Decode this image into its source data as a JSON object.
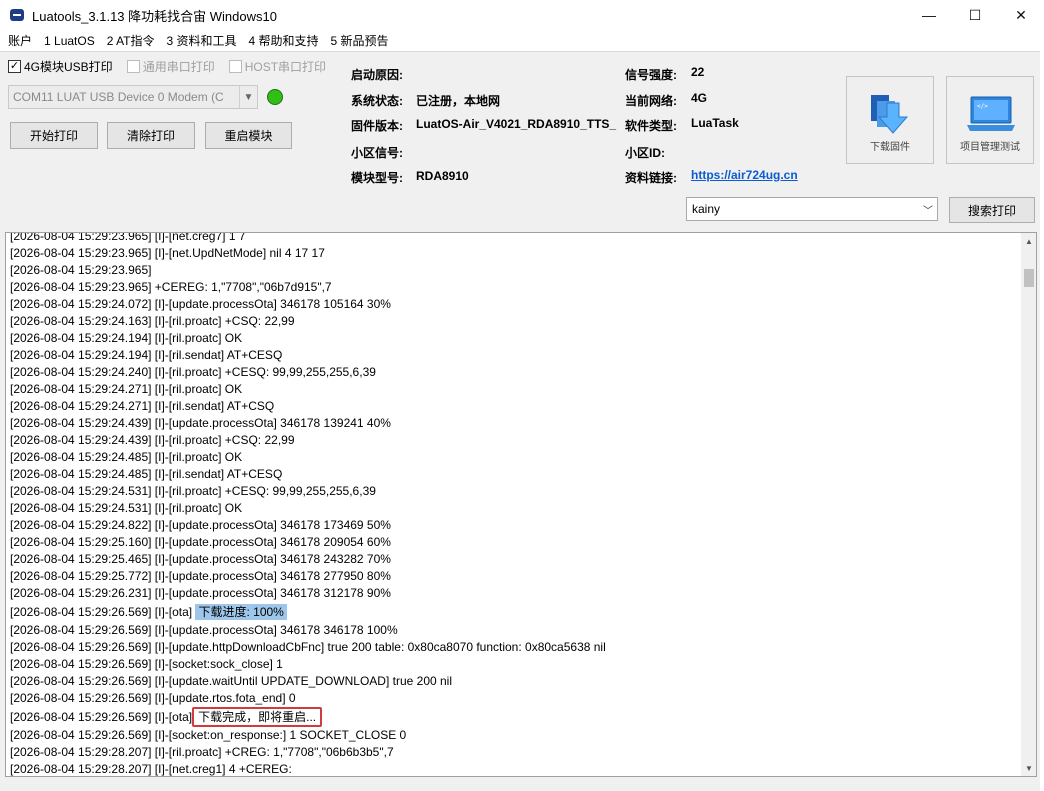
{
  "window": {
    "title": "Luatools_3.1.13 降功耗找合宙 Windows10",
    "minimize": "—",
    "maximize": "☐",
    "close": "✕"
  },
  "menu": [
    "账户",
    "1 LuatOS",
    "2 AT指令",
    "3 资料和工具",
    "4 帮助和支持",
    "5 新品预告"
  ],
  "options": {
    "usb_print": {
      "label": "4G模块USB打印",
      "checked": true
    },
    "serial_print": {
      "label": "通用串口打印",
      "checked": false
    },
    "host_print": {
      "label": "HOST串口打印",
      "checked": false
    }
  },
  "port": {
    "value": "COM11 LUAT USB Device 0 Modem (C",
    "status_color": "#2fbf17"
  },
  "buttons": {
    "start_print": "开始打印",
    "clear_print": "清除打印",
    "restart_module": "重启模块",
    "search_print": "搜索打印"
  },
  "info": {
    "boot_reason": {
      "label": "启动原因:",
      "value": ""
    },
    "system_status": {
      "label": "系统状态:",
      "value": "已注册，本地网"
    },
    "firmware": {
      "label": "固件版本:",
      "value": "LuatOS-Air_V4021_RDA8910_TTS_"
    },
    "cell_signal": {
      "label": "小区信号:",
      "value": ""
    },
    "module_model": {
      "label": "模块型号:",
      "value": "RDA8910"
    },
    "signal_strength": {
      "label": "信号强度:",
      "value": "22"
    },
    "network": {
      "label": "当前网络:",
      "value": "4G"
    },
    "software_type": {
      "label": "软件类型:",
      "value": "LuaTask"
    },
    "cell_id": {
      "label": "小区ID:",
      "value": ""
    },
    "resource_link": {
      "label": "资料链接:",
      "value": "https://air724ug.cn"
    }
  },
  "tools": {
    "download_firmware": "下载固件",
    "project_manager": "项目管理测试"
  },
  "filter": {
    "value": "kainy"
  },
  "log": [
    {
      "text": "[2026-08-04 15:29:23.965] [I]-[net.creg7] 1 7"
    },
    {
      "text": "[2026-08-04 15:29:23.965] [I]-[net.UpdNetMode] nil 4 17 17"
    },
    {
      "text": "[2026-08-04 15:29:23.965]"
    },
    {
      "text": "[2026-08-04 15:29:23.965] +CEREG: 1,\"7708\",\"06b7d915\",7"
    },
    {
      "text": "[2026-08-04 15:29:24.072] [I]-[update.processOta] 346178 105164 30%"
    },
    {
      "text": "[2026-08-04 15:29:24.163] [I]-[ril.proatc] +CSQ: 22,99"
    },
    {
      "text": "[2026-08-04 15:29:24.194] [I]-[ril.proatc] OK"
    },
    {
      "text": "[2026-08-04 15:29:24.194] [I]-[ril.sendat] AT+CESQ"
    },
    {
      "text": "[2026-08-04 15:29:24.240] [I]-[ril.proatc] +CESQ: 99,99,255,255,6,39"
    },
    {
      "text": "[2026-08-04 15:29:24.271] [I]-[ril.proatc] OK"
    },
    {
      "text": "[2026-08-04 15:29:24.271] [I]-[ril.sendat] AT+CSQ"
    },
    {
      "text": "[2026-08-04 15:29:24.439] [I]-[update.processOta] 346178 139241 40%"
    },
    {
      "text": "[2026-08-04 15:29:24.439] [I]-[ril.proatc] +CSQ: 22,99"
    },
    {
      "text": "[2026-08-04 15:29:24.485] [I]-[ril.proatc] OK"
    },
    {
      "text": "[2026-08-04 15:29:24.485] [I]-[ril.sendat] AT+CESQ"
    },
    {
      "text": "[2026-08-04 15:29:24.531] [I]-[ril.proatc] +CESQ: 99,99,255,255,6,39"
    },
    {
      "text": "[2026-08-04 15:29:24.531] [I]-[ril.proatc] OK"
    },
    {
      "text": "[2026-08-04 15:29:24.822] [I]-[update.processOta] 346178 173469 50%"
    },
    {
      "text": "[2026-08-04 15:29:25.160] [I]-[update.processOta] 346178 209054 60%"
    },
    {
      "text": "[2026-08-04 15:29:25.465] [I]-[update.processOta] 346178 243282 70%"
    },
    {
      "text": "[2026-08-04 15:29:25.772] [I]-[update.processOta] 346178 277950 80%"
    },
    {
      "text": "[2026-08-04 15:29:26.231] [I]-[update.processOta] 346178 312178 90%"
    },
    {
      "text": "[2026-08-04 15:29:26.569] [I]-[ota]",
      "highlight": "下载进度: 100%"
    },
    {
      "text": "[2026-08-04 15:29:26.569] [I]-[update.processOta] 346178 346178 100%"
    },
    {
      "text": "[2026-08-04 15:29:26.569] [I]-[update.httpDownloadCbFnc] true 200 table: 0x80ca8070 function: 0x80ca5638 nil"
    },
    {
      "text": "[2026-08-04 15:29:26.569] [I]-[socket:sock_close] 1"
    },
    {
      "text": "[2026-08-04 15:29:26.569] [I]-[update.waitUntil UPDATE_DOWNLOAD] true 200 nil"
    },
    {
      "text": "[2026-08-04 15:29:26.569] [I]-[update.rtos.fota_end] 0"
    },
    {
      "text": "[2026-08-04 15:29:26.569] [I]-[ota]",
      "boxed": "下载完成，即将重启..."
    },
    {
      "text": "[2026-08-04 15:29:26.569] [I]-[socket:on_response:] 1 SOCKET_CLOSE 0"
    },
    {
      "text": "[2026-08-04 15:29:28.207] [I]-[ril.proatc] +CREG: 1,\"7708\",\"06b6b3b5\",7"
    },
    {
      "text": "[2026-08-04 15:29:28.207] [I]-[net.creg1] 4 +CEREG:"
    }
  ]
}
